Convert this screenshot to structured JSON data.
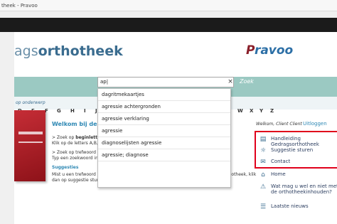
{
  "window": {
    "title": "theek - Pravoo"
  },
  "header": {
    "logo_regular": "ags",
    "logo_bold": "orthotheek",
    "pravoo_p": "P",
    "pravoo_rest": "ravoo"
  },
  "search": {
    "value": "ap|",
    "clear": "×",
    "button_label": "Zoek",
    "suggestions": [
      "dagritmekaartjes",
      "agressie achtergronden",
      "agressie verklaring",
      "agressie",
      "diagnoselijsten agressie",
      "agressie; diagnose"
    ]
  },
  "subject_row": "op onderwerp",
  "letters": [
    "D",
    "E",
    "F",
    "G",
    "H",
    "I",
    "J",
    "V",
    "W",
    "X",
    "Y",
    "Z"
  ],
  "main": {
    "welcome": "Welkom bij de d",
    "line1_prefix": "> Zoek op ",
    "line1_bold": "beginlette",
    "line2": "Klik op de letters A,B,C",
    "line3": "> Zoek op trefwoord o",
    "line4": "Typ een zoekwoord in het zoekveld om op onderwerp of trefwoord te zoeken.",
    "suggestions_title": "Suggesties",
    "suggestions_text": "Mist u een trefwoord of heeft u inhoudelijke suggesties voor de digitale gedragsorthotheek, klik dan op suggestie sturen."
  },
  "sidebar": {
    "welcome": "Welkom, Client Client",
    "logout": "Uitloggen",
    "items": [
      {
        "label": "Handleiding Gedragsorthotheek",
        "icon": "book-icon"
      },
      {
        "label": "Suggestie sturen",
        "icon": "sun-icon"
      },
      {
        "label": "Contact",
        "icon": "envelope-icon"
      },
      {
        "label": "Home",
        "icon": "house-icon"
      },
      {
        "label": "Wat mag u wel en niet met de orthotheekinhouden?",
        "icon": "warning-icon"
      },
      {
        "label": "Laatste nieuws",
        "icon": "news-icon"
      }
    ]
  },
  "colors": {
    "accent": "#2e88b4",
    "searchbar": "#9bc9c2",
    "highlight": "#e0001b",
    "brand_dark": "#8a1f2a"
  }
}
